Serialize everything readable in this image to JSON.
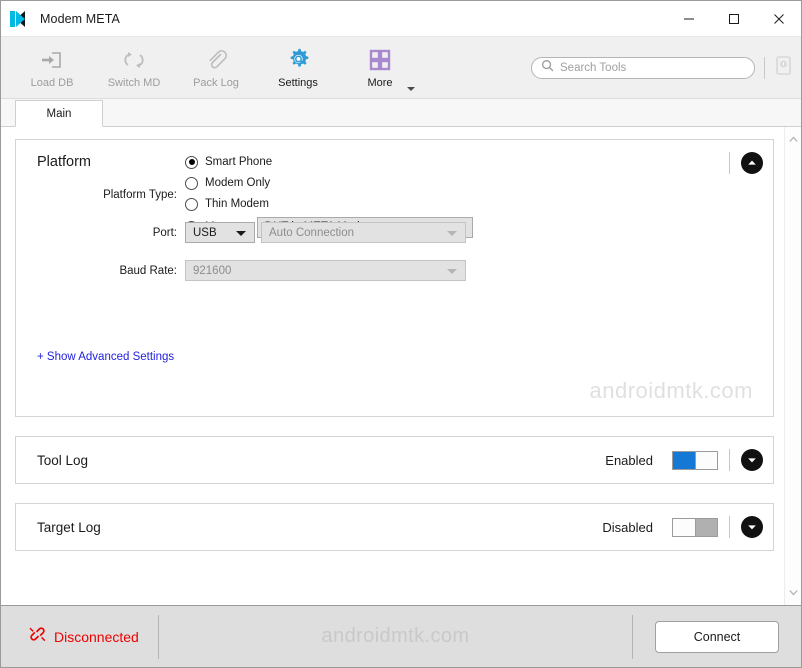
{
  "window": {
    "title": "Modem META",
    "logo_icon": "modem-meta-logo-icon",
    "minimize_icon": "minimize-icon",
    "maximize_icon": "maximize-icon",
    "close_icon": "close-icon"
  },
  "toolbar": {
    "items": [
      {
        "label": "Load DB",
        "icon": "load-db-icon",
        "enabled": false
      },
      {
        "label": "Switch MD",
        "icon": "switch-md-icon",
        "enabled": false
      },
      {
        "label": "Pack Log",
        "icon": "pack-log-icon",
        "enabled": false
      },
      {
        "label": "Settings",
        "icon": "settings-gear-icon",
        "enabled": true
      },
      {
        "label": "More",
        "icon": "more-grid-icon",
        "enabled": true
      }
    ],
    "search": {
      "placeholder": "Search Tools",
      "value": "",
      "icon": "search-icon"
    },
    "device_info_icon": "device-info-icon"
  },
  "tabs": [
    {
      "label": "Main",
      "active": true
    }
  ],
  "platform_panel": {
    "title": "Platform",
    "collapse_icon": "chevron-up-icon",
    "platform_type_label": "Platform Type:",
    "radios": [
      {
        "label": "Smart Phone",
        "selected": true
      },
      {
        "label": "Modem Only",
        "selected": false
      },
      {
        "label": "Thin Modem",
        "selected": false
      },
      {
        "label": "More...",
        "selected": false
      }
    ],
    "more_combo": {
      "value": "DUT in META Mode",
      "disabled": false
    },
    "port_label": "Port:",
    "port_combo": {
      "value": "USB",
      "disabled": false
    },
    "connection_combo": {
      "value": "Auto Connection",
      "disabled": true
    },
    "baud_label": "Baud Rate:",
    "baud_combo": {
      "value": "921600",
      "disabled": true
    },
    "advanced_link": "+ Show Advanced Settings",
    "watermark": "androidmtk.com"
  },
  "tool_log_panel": {
    "title": "Tool Log",
    "state_label": "Enabled",
    "enabled": true,
    "expand_icon": "chevron-down-icon"
  },
  "target_log_panel": {
    "title": "Target Log",
    "state_label": "Disabled",
    "enabled": false,
    "expand_icon": "chevron-down-icon"
  },
  "scrollbar": {
    "up_icon": "scroll-up-icon",
    "down_icon": "scroll-down-icon"
  },
  "statusbar": {
    "status_icon": "disconnected-link-icon",
    "status_text": "Disconnected",
    "watermark": "androidmtk.com",
    "connect_label": "Connect"
  },
  "colors": {
    "accent_blue": "#1478d4",
    "settings_icon": "#2e9bd6",
    "more_icon": "#a888cf",
    "status_red": "#ee0000",
    "link_blue": "#2222dd",
    "logo_cyan": "#00b9e4"
  }
}
